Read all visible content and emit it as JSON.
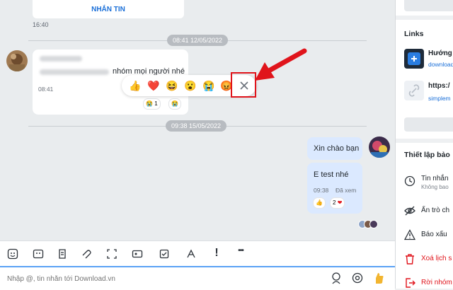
{
  "chat": {
    "top_card_button": "NHẮN TIN",
    "top_card_time": "16:40",
    "date_divider_1": "08:41 12/05/2022",
    "incoming_message_text": "nhóm mọi người nhé",
    "incoming_message_time": "08:41",
    "reaction_emojis": [
      "👍",
      "❤️",
      "😆",
      "😮",
      "😭",
      "😡"
    ],
    "reaction_count_incoming": "1",
    "date_divider_2": "09:38 15/05/2022",
    "outgoing_message_1": "Xin chào bạn",
    "outgoing_message_2": "E test nhé",
    "outgoing_time": "09:38",
    "seen_status": "Đã xem",
    "reaction_count_outgoing": "2"
  },
  "toolbar": {
    "icons": [
      "sticker-icon",
      "emoji-icon",
      "image-icon",
      "attach-icon",
      "screenshot-icon",
      "contact-card-icon",
      "todo-icon",
      "format-icon",
      "important-icon",
      "more-icon"
    ],
    "important_label": "!",
    "more_label": "•••"
  },
  "composer": {
    "placeholder": "Nhập @, tin nhắn tới Download.vn"
  },
  "sidebar": {
    "links_title": "Links",
    "link_1_title": "Hướng",
    "link_1_url": "download",
    "link_2_title": "https:/",
    "link_2_url": "simplem",
    "settings_title": "Thiết lập bảo",
    "self_destruct_label": "Tin nhắn",
    "self_destruct_value": "Không bao",
    "hide_chat_label": "Ẩn trò ch",
    "report_label": "Báo xấu",
    "delete_history_label": "Xoá lịch s",
    "leave_group_label": "Rời nhóm"
  },
  "colors": {
    "accent_blue": "#1a6fd8",
    "highlight_red": "#e0141b",
    "outgoing_bubble": "#dbe9ff"
  }
}
